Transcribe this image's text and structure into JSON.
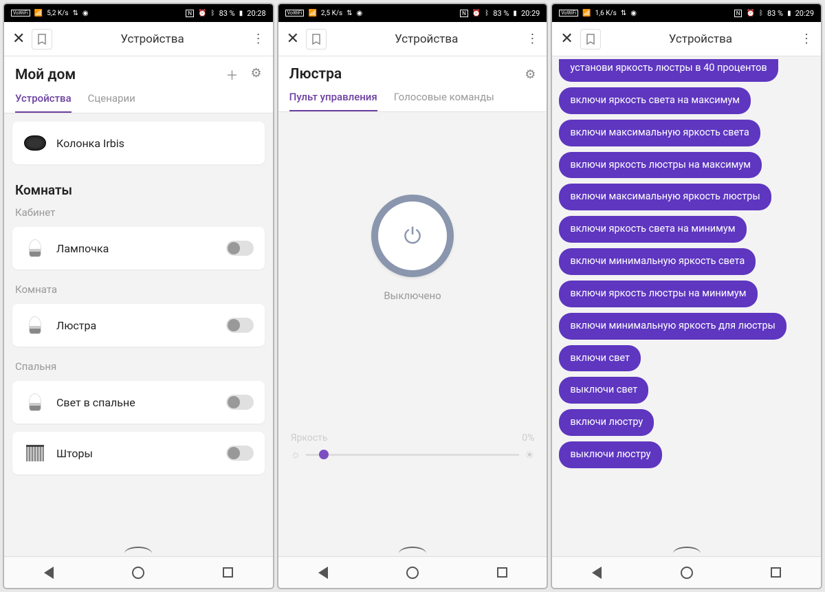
{
  "status": {
    "vowifi": "VoWiFi",
    "net1": "5,2 K/s",
    "net2": "2,5 K/s",
    "net3": "1,6 K/s",
    "nfc": "N",
    "battery": "83 %",
    "t1": "20:28",
    "t2": "20:29",
    "t3": "20:29"
  },
  "topbar": {
    "title": "Устройства"
  },
  "screen1": {
    "header": "Мой дом",
    "tab1": "Устройства",
    "tab2": "Сценарии",
    "speaker": "Колонка Irbis",
    "roomsHeading": "Комнаты",
    "rooms": [
      {
        "name": "Кабинет",
        "devices": [
          {
            "label": "Лампочка",
            "icon": "bulb"
          }
        ]
      },
      {
        "name": "Комната",
        "devices": [
          {
            "label": "Люстра",
            "icon": "bulb"
          }
        ]
      },
      {
        "name": "Спальня",
        "devices": [
          {
            "label": "Свет в спальне",
            "icon": "bulb"
          },
          {
            "label": "Шторы",
            "icon": "curtain"
          }
        ]
      }
    ]
  },
  "screen2": {
    "header": "Люстра",
    "tab1": "Пульт управления",
    "tab2": "Голосовые команды",
    "state": "Выключено",
    "brightLabel": "Яркость",
    "brightValue": "0%"
  },
  "screen3": {
    "commands": [
      "установи яркость люстры в 40 процентов",
      "включи яркость света на максимум",
      "включи максимальную яркость света",
      "включи яркость люстры на максимум",
      "включи максимальную яркость люстры",
      "включи яркость света на минимум",
      "включи минимальную яркость света",
      "включи яркость люстры на минимум",
      "включи минимальную яркость для люстры",
      "включи свет",
      "выключи свет",
      "включи люстру",
      "выключи люстру"
    ]
  }
}
